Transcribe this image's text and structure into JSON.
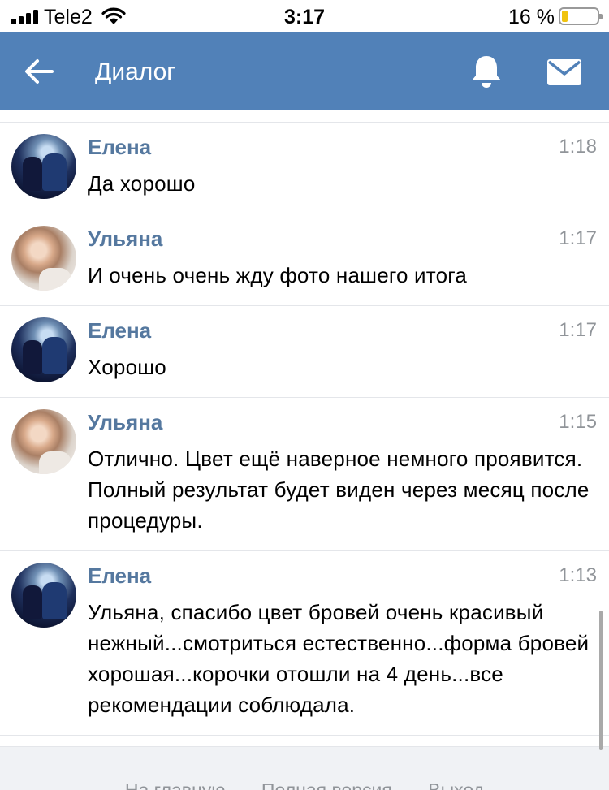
{
  "status_bar": {
    "carrier": "Tele2",
    "time": "3:17",
    "battery_percent": "16 %",
    "battery_level": 0.16,
    "battery_color": "#f0c30f"
  },
  "header": {
    "title": "Диалог",
    "background": "#5181b8",
    "icons": [
      "back-arrow-icon",
      "bell-icon",
      "mail-icon"
    ]
  },
  "messages": [
    {
      "author": "Елена",
      "time": "1:18",
      "text": "Да хорошо",
      "avatar": "elena"
    },
    {
      "author": "Ульяна",
      "time": "1:17",
      "text": "И очень очень жду фото нашего итога",
      "avatar": "ulyana"
    },
    {
      "author": "Елена",
      "time": "1:17",
      "text": "Хорошо",
      "avatar": "elena"
    },
    {
      "author": "Ульяна",
      "time": "1:15",
      "text": "Отлично. Цвет ещё наверное немного проявится. Полный результат будет виден через месяц после процедуры.",
      "avatar": "ulyana"
    },
    {
      "author": "Елена",
      "time": "1:13",
      "text": "Ульяна, спасибо цвет бровей очень красивый нежный...смотриться естественно...форма бровей хорошая...корочки отошли на 4 день...все рекомендации соблюдала.",
      "avatar": "elena"
    }
  ],
  "footer": {
    "links": [
      "На главную",
      "Полная версия",
      "Выход"
    ],
    "separator": "·"
  },
  "colors": {
    "author_name": "#55789f",
    "timestamp": "#909499"
  }
}
